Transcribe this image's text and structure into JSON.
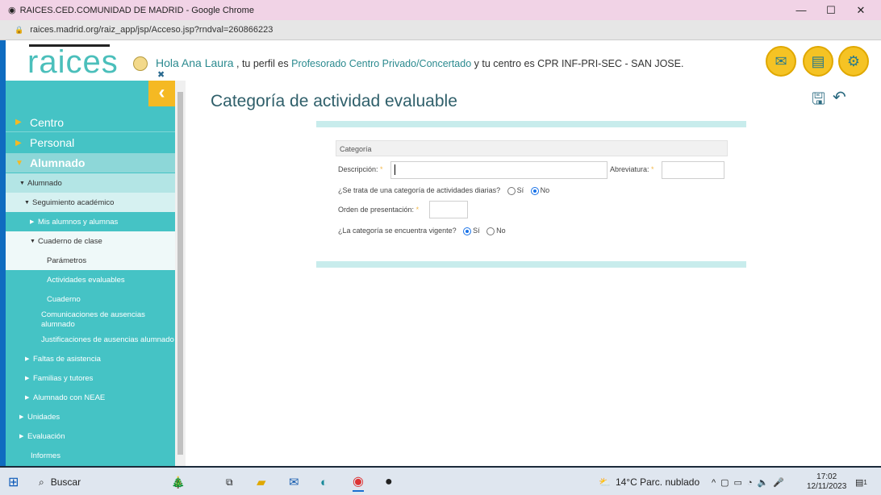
{
  "window": {
    "title": "RAICES.CED.COMUNIDAD DE MADRID - Google Chrome",
    "url": "raices.madrid.org/raiz_app/jsp/Acceso.jsp?rndval=260866223"
  },
  "header": {
    "logo": "raices",
    "hello": "Hola Ana Laura",
    "t1": ", tu perfil es",
    "profile": "Profesorado Centro Privado/Concertado",
    "t2": "y tu centro es CPR INF-PRI-SEC - SAN JOSE."
  },
  "sidebar": {
    "items": [
      "Centro",
      "Personal",
      "Alumnado",
      "Alumnado",
      "Seguimiento académico",
      "Mis alumnos y alumnas",
      "Cuaderno de clase",
      "Parámetros",
      "Actividades evaluables",
      "Cuaderno",
      "Comunicaciones de ausencias alumnado",
      "Justificaciones de ausencias alumnado",
      "Faltas de asistencia",
      "Familias y tutores",
      "Alumnado con NEAE",
      "Unidades",
      "Evaluación",
      "Informes"
    ]
  },
  "main": {
    "title": "Categoría de actividad evaluable",
    "fieldset": "Categoría",
    "descripcion_label": "Descripción:",
    "descripcion_value": "",
    "abreviatura_label": "Abreviatura:",
    "diarias_label": "¿Se trata de una categoría de actividades diarias?",
    "yes": "Sí",
    "no": "No",
    "diarias_value": "No",
    "orden_label": "Orden de presentación:",
    "vigente_label": "¿La categoría se encuentra vigente?",
    "vigente_value": "Sí",
    "req": "*"
  },
  "taskbar": {
    "search": "Buscar",
    "weather": "14°C  Parc. nublado",
    "time": "17:02",
    "date": "12/11/2023",
    "notifications": "1"
  }
}
